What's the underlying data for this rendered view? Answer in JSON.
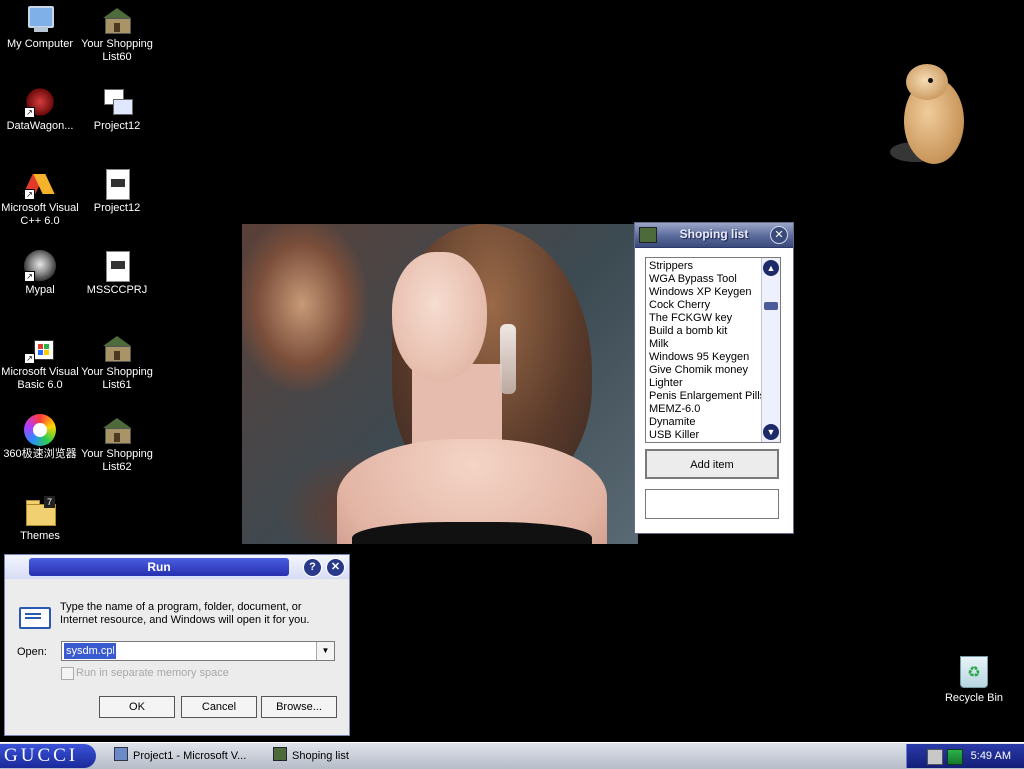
{
  "desktop": {
    "icons": [
      {
        "label": "My Computer"
      },
      {
        "label": "Your Shopping List60"
      },
      {
        "label": "DataWagon..."
      },
      {
        "label": "Project12"
      },
      {
        "label": "Microsoft Visual C++ 6.0"
      },
      {
        "label": "Project12"
      },
      {
        "label": "Mypal"
      },
      {
        "label": "MSSCCPRJ"
      },
      {
        "label": "Microsoft Visual Basic 6.0"
      },
      {
        "label": "Your Shopping List61"
      },
      {
        "label": "360极速浏览器"
      },
      {
        "label": "Your Shopping List62"
      },
      {
        "label": "Themes"
      }
    ],
    "recycle_bin": "Recycle Bin"
  },
  "shopping_window": {
    "title": "Shoping list",
    "items": [
      "Strippers",
      "WGA Bypass Tool",
      "Windows XP Keygen",
      "Cock Cherry",
      "The FCKGW key",
      "Build a bomb kit",
      "Milk",
      "Windows 95 Keygen",
      "Give Chomik money",
      "Lighter",
      "Penis Enlargement Pills",
      "MEMZ-6.0",
      "Dynamite",
      "USB Killer"
    ],
    "add_button": "Add item",
    "input_value": ""
  },
  "run_dialog": {
    "title": "Run",
    "help_glyph": "?",
    "close_glyph": "✕",
    "description": "Type the name of a program, folder, document, or Internet resource, and Windows will open it for you.",
    "open_label": "Open:",
    "open_value": "sysdm.cpl",
    "checkbox_label": "Run in separate memory space",
    "ok": "OK",
    "cancel": "Cancel",
    "browse": "Browse..."
  },
  "taskbar": {
    "start_label": "GUCCI",
    "tasks": [
      {
        "label": "Project1 - Microsoft V..."
      },
      {
        "label": "Shoping list"
      }
    ],
    "clock": "5:49 AM"
  }
}
